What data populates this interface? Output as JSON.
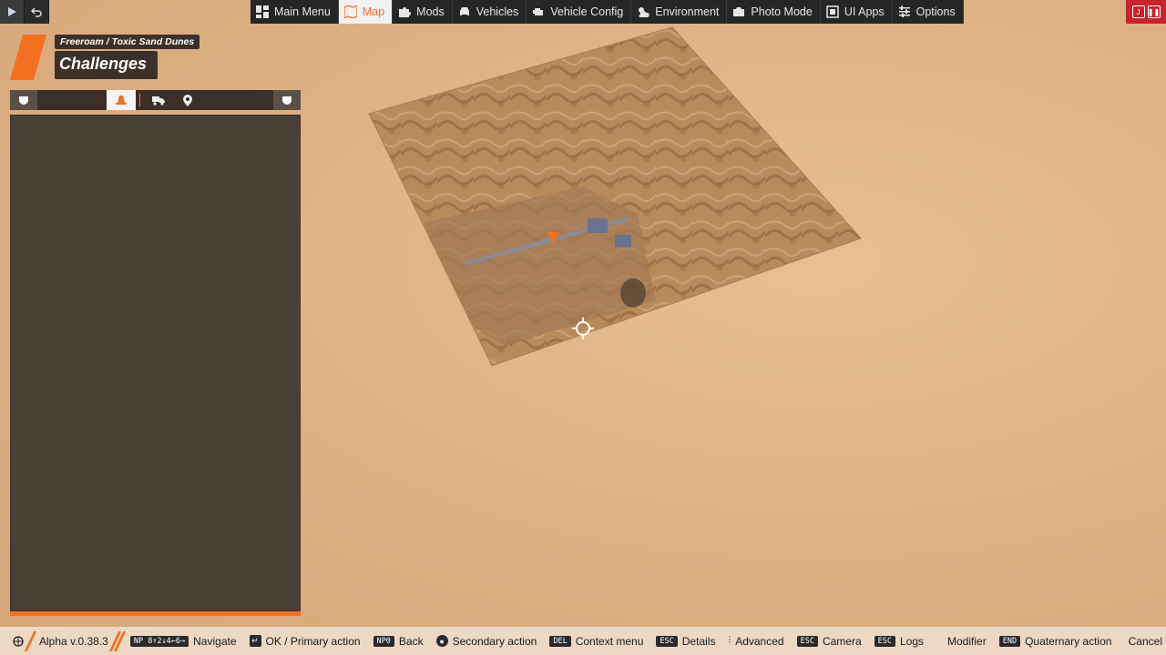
{
  "topbar": {
    "items": [
      {
        "label": "Main Menu",
        "icon": "dashboard-icon"
      },
      {
        "label": "Map",
        "icon": "map-icon",
        "active": true
      },
      {
        "label": "Mods",
        "icon": "puzzle-icon"
      },
      {
        "label": "Vehicles",
        "icon": "car-icon"
      },
      {
        "label": "Vehicle Config",
        "icon": "engine-icon"
      },
      {
        "label": "Environment",
        "icon": "sun-cloud-icon"
      },
      {
        "label": "Photo Mode",
        "icon": "camera-icon"
      },
      {
        "label": "UI Apps",
        "icon": "apps-icon"
      },
      {
        "label": "Options",
        "icon": "sliders-icon"
      }
    ]
  },
  "header": {
    "breadcrumb": "Freeroam / Toxic Sand Dunes",
    "title": "Challenges"
  },
  "accent_color": "#f37021",
  "bottombar": {
    "version": "Alpha v.0.38.3",
    "navigate_key": "NP 8↑2↓4←6→",
    "navigate": "Navigate",
    "ok": "OK / Primary action",
    "back_key": "NP0",
    "back": "Back",
    "secondary": "Secondary action",
    "context_key": "DEL",
    "context": "Context menu",
    "details_key": "ESC",
    "details": "Details",
    "advanced": "Advanced",
    "camera_key": "ESC",
    "camera": "Camera",
    "logs_key": "ESC",
    "logs": "Logs",
    "modifier": "Modifier",
    "quaternary_key": "END",
    "quaternary": "Quaternary action",
    "cancel": "Cancel"
  }
}
